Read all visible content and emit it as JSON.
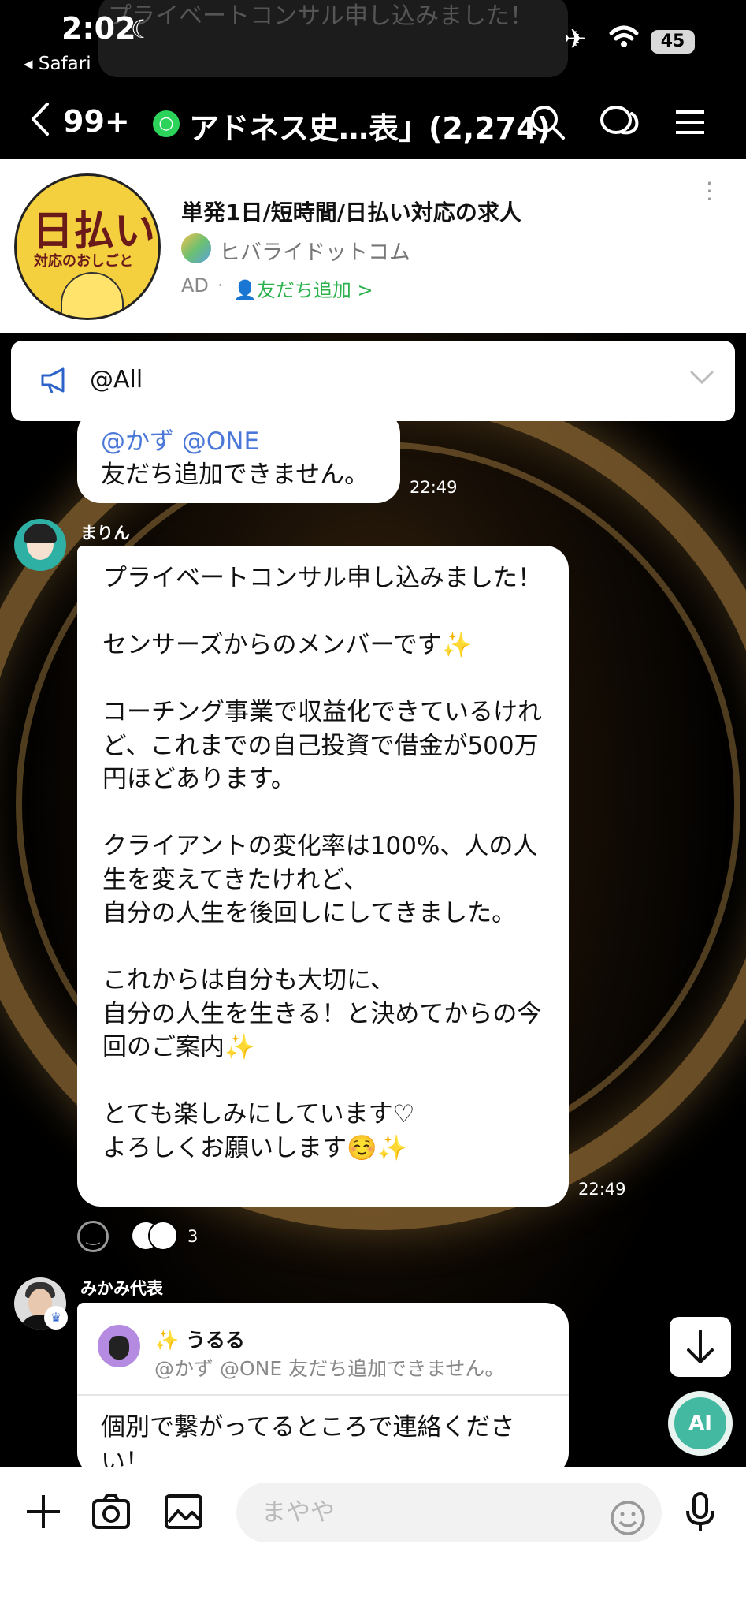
{
  "status_bar": {
    "time": "2:02",
    "back_app": "◂ Safari",
    "battery": "45",
    "ghost_text": "プライベートコンサル申し込みました！",
    "ghost_time": "22:49"
  },
  "nav": {
    "unread_count": "99+",
    "room_title": "アドネス史…表」(2,274)"
  },
  "ad": {
    "logo_line1": "日払い",
    "logo_line2": "対応のおしごと",
    "headline": "単発1日/短時間/日払い対応の求人",
    "brand": "ヒバライドットコム",
    "ad_tag": "AD",
    "separator": "·",
    "add_friend": "友だち追加 >"
  },
  "announcement": {
    "text": "@All"
  },
  "messages": [
    {
      "mention": "@かず @ONE",
      "body": "友だち追加できません。",
      "time": "22:49"
    },
    {
      "sender": "まりん",
      "body": "プライベートコンサル申し込みました！\n\nセンサーズからのメンバーです✨\n\nコーチング事業で収益化できているけれど、これまでの自己投資で借金が500万円ほどあります。\n\nクライアントの変化率は100%、人の人生を変えてきたけれど、\n自分の人生を後回しにしてきました。\n\nこれからは自分も大切に、\n自分の人生を生きる！と決めてからの今回のご案内✨\n\nとても楽しみにしています♡\nよろしくお願いします☺️✨",
      "time": "22:49",
      "reaction_count": "3"
    },
    {
      "sender": "みかみ代表",
      "reply_name": "✨ うるる",
      "reply_text": "@かず @ONE 友だち追加できません。",
      "body": "個別で繋がってるところで連絡ください！"
    }
  ],
  "ai_button": "AI",
  "composer": {
    "placeholder": "まやや"
  },
  "icons": [
    "chevron-left-icon",
    "community-icon",
    "search-icon",
    "chat-bubbles-icon",
    "menu-icon",
    "megaphone-icon",
    "chevron-down-icon",
    "emoji-icon",
    "arrow-down-icon",
    "plus-icon",
    "camera-icon",
    "image-icon",
    "microphone-icon"
  ]
}
